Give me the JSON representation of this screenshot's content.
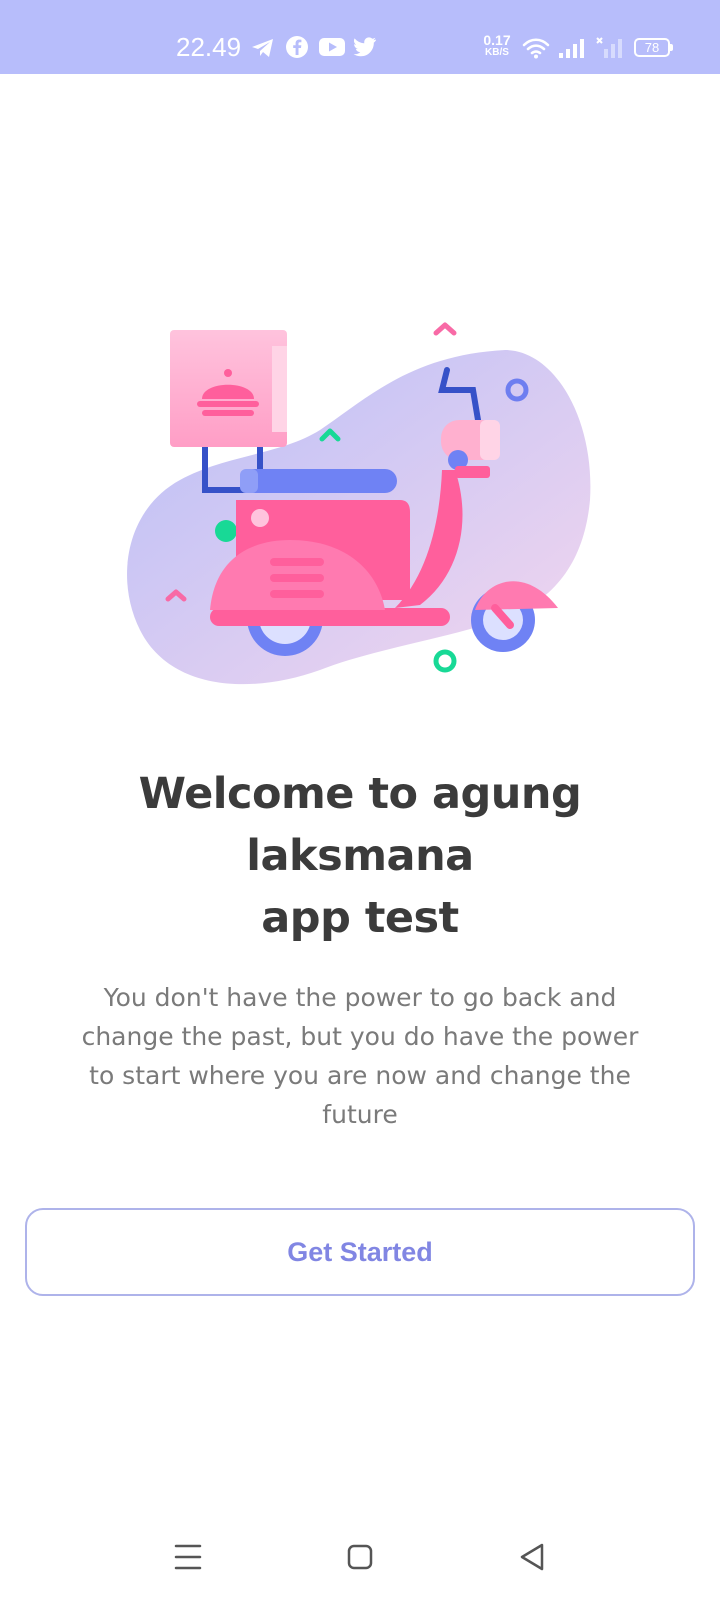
{
  "status_bar": {
    "time": "22.49",
    "notification_icons": [
      "telegram-icon",
      "facebook-icon",
      "youtube-icon",
      "twitter-icon"
    ],
    "net_speed_value": "0.17",
    "net_speed_unit": "KB/S",
    "system_icons": [
      "wifi-icon",
      "signal-icon",
      "signal-icon-secondary"
    ],
    "battery": "78",
    "background": "#b7bdfb"
  },
  "onboarding": {
    "illustration": "delivery-scooter-illustration",
    "title_line1": "Welcome to agung laksmana",
    "title_line2": "app test",
    "subtitle_line1": "You don't have the power to go back and",
    "subtitle_line2": "change the past, but you do have the power",
    "subtitle_line3": "to start where you are now and change the",
    "subtitle_line4": "future",
    "button_label": "Get Started",
    "accent_color": "#8186e3"
  },
  "nav_bar": {
    "icons": [
      "menu-icon",
      "home-icon",
      "back-icon"
    ]
  }
}
